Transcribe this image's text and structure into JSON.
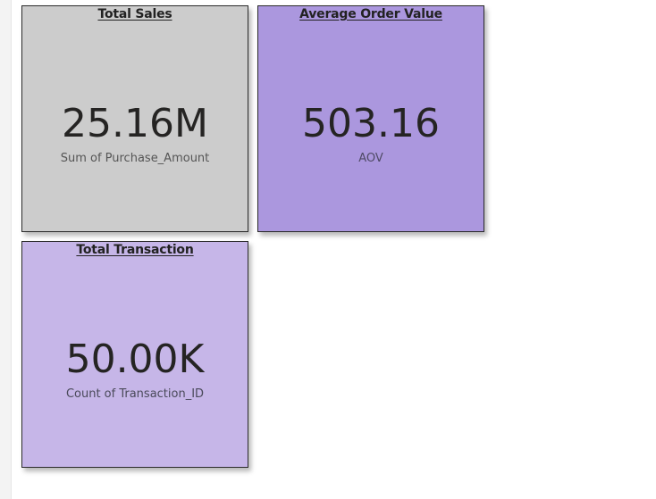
{
  "cards": [
    {
      "title": "Total Sales",
      "value": "25.16M",
      "caption": "Sum of Purchase_Amount",
      "background": "#cccccc"
    },
    {
      "title": "Average Order Value",
      "value": "503.16",
      "caption": "AOV",
      "background": "#ab97de"
    },
    {
      "title": "Total Transaction",
      "value": "50.00K",
      "caption": "Count of Transaction_ID",
      "background": "#c6b6e8"
    }
  ]
}
